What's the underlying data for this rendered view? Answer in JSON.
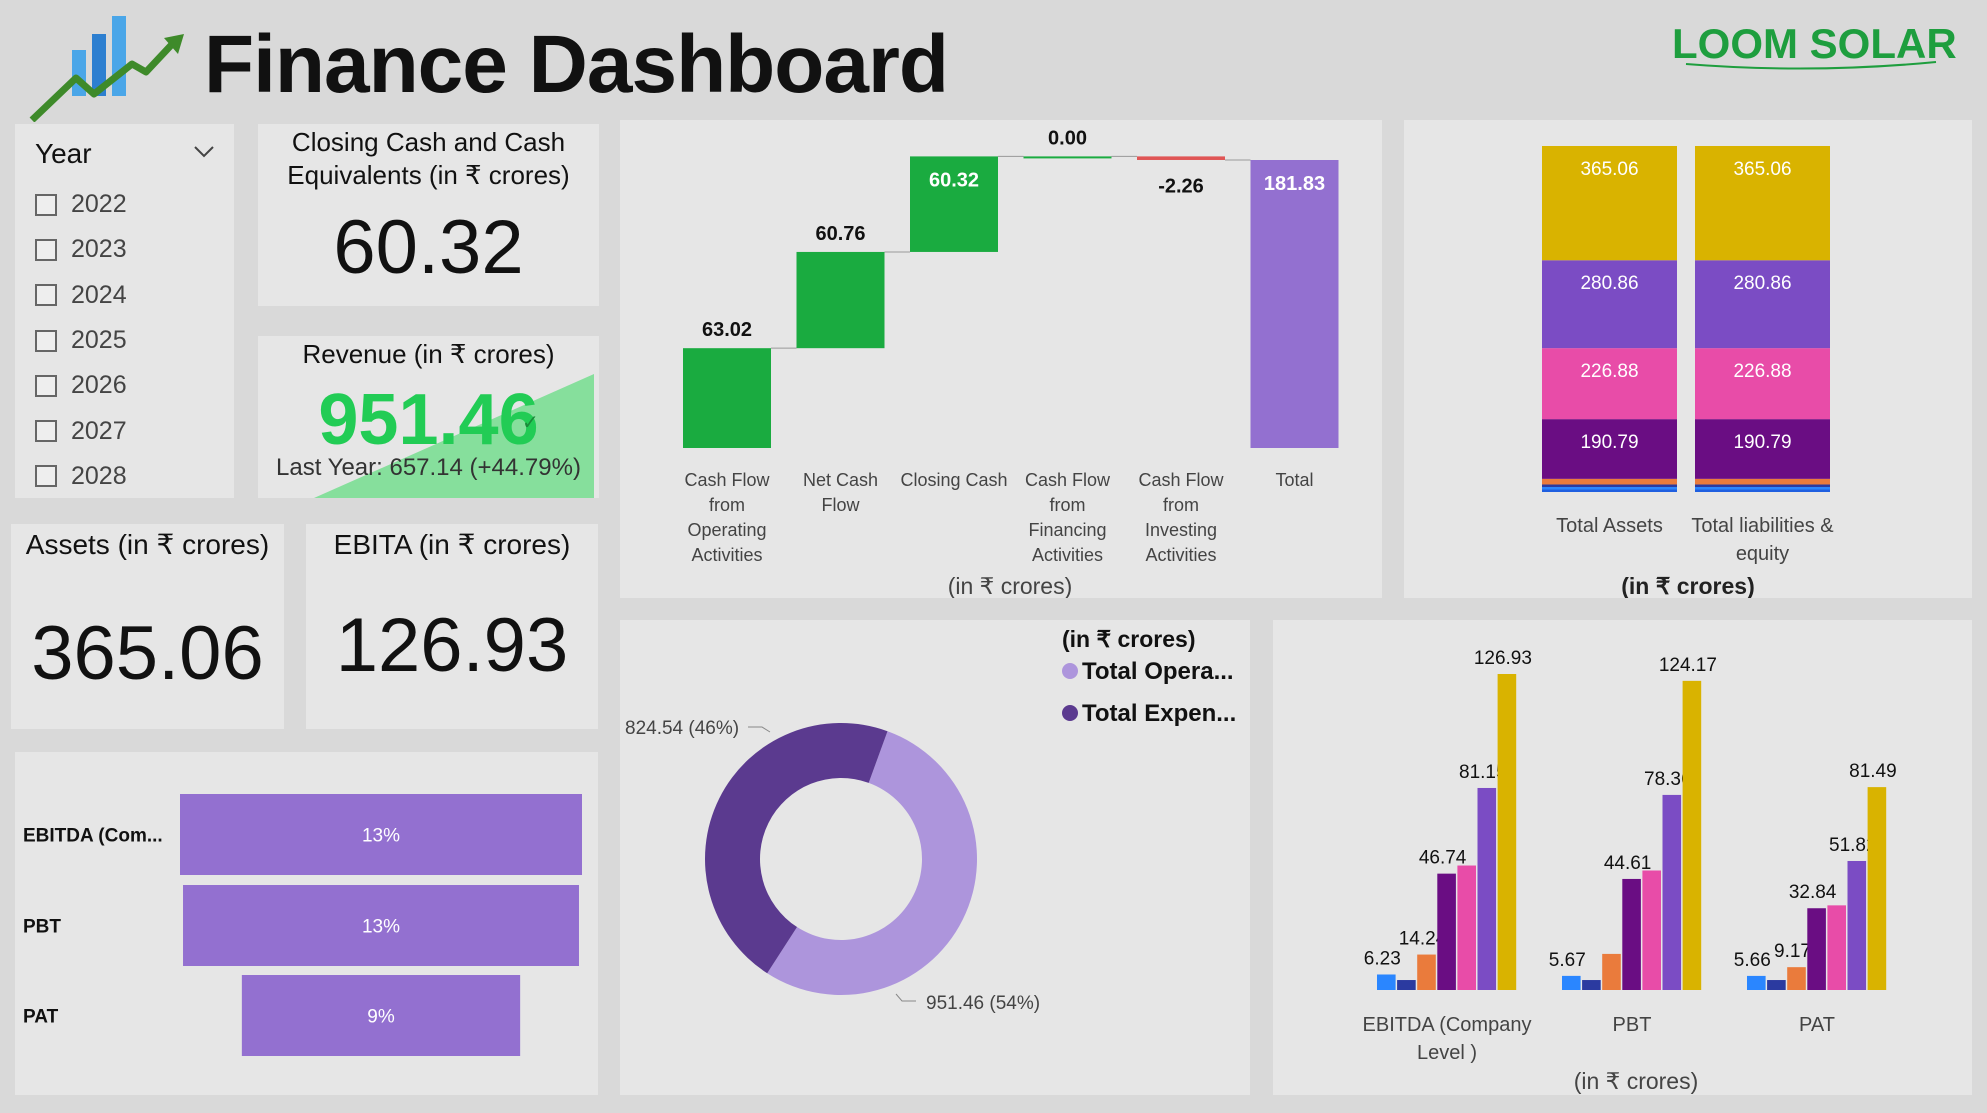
{
  "header": {
    "title": "Finance Dashboard",
    "brand": "LOOM SOLAR",
    "colors": {
      "brand_green": "#1e9e3e"
    }
  },
  "year_slicer": {
    "title": "Year",
    "options": [
      "2022",
      "2023",
      "2024",
      "2025",
      "2026",
      "2027",
      "2028"
    ]
  },
  "kpis": {
    "closing_cash": {
      "title": "Closing Cash and Cash Equivalents (in ₹ crores)",
      "value": "60.32"
    },
    "revenue": {
      "title": "Revenue (in ₹ crores)",
      "value": "951.46",
      "subtext": "Last Year: 657.14 (+44.79%)",
      "status_color": "#22cc55"
    },
    "assets": {
      "title": "Assets (in ₹ crores)",
      "value": "365.06"
    },
    "ebita": {
      "title": "EBITA (in ₹ crores)",
      "value": "126.93"
    }
  },
  "chart_data": [
    {
      "id": "waterfall",
      "type": "bar",
      "subtype": "waterfall",
      "categories": [
        "Cash Flow from Operating Activities",
        "Net Cash Flow",
        "Closing Cash",
        "Cash Flow from Financing Activities",
        "Cash Flow from Investing Activities",
        "Total"
      ],
      "category_lines": [
        [
          "Cash Flow",
          "from",
          "Operating",
          "Activities"
        ],
        [
          "Net Cash",
          "Flow"
        ],
        [
          "Closing Cash"
        ],
        [
          "Cash Flow",
          "from",
          "Financing",
          "Activities"
        ],
        [
          "Cash Flow",
          "from",
          "Investing",
          "Activities"
        ],
        [
          "Total"
        ]
      ],
      "values": [
        63.02,
        60.76,
        60.32,
        0.0,
        -2.26,
        181.83
      ],
      "value_labels": [
        "63.02",
        "60.76",
        "60.32",
        "0.00",
        "-2.26",
        "181.83"
      ],
      "colors": {
        "increase": "#1aab40",
        "decrease": "#e05555",
        "total": "#9370d0"
      },
      "xlabel": "(in ₹ crores)",
      "ylim": [
        0,
        181.83
      ]
    },
    {
      "id": "stacked",
      "type": "bar",
      "subtype": "stacked",
      "categories": [
        "Total Assets",
        "Total liabilities & equity"
      ],
      "category_lines": [
        [
          "Total Assets"
        ],
        [
          "Total liabilities &",
          "equity"
        ]
      ],
      "series": [
        {
          "values": [
            8,
            8
          ],
          "color": "#1f5fe0"
        },
        {
          "values": [
            8,
            8
          ],
          "color": "#2a86ff"
        },
        {
          "values": [
            8,
            8
          ],
          "color": "#2b3aa0"
        },
        {
          "values": [
            18,
            18
          ],
          "color": "#ea7b3c"
        },
        {
          "values": [
            190.79,
            190.79
          ],
          "color": "#6a0d83"
        },
        {
          "values": [
            226.88,
            226.88
          ],
          "color": "#e84ca8"
        },
        {
          "values": [
            280.86,
            280.86
          ],
          "color": "#7b4cc4"
        },
        {
          "values": [
            365.06,
            365.06
          ],
          "color": "#d9b300"
        }
      ],
      "value_labels": [
        "190.79",
        "226.88",
        "280.86",
        "365.06"
      ],
      "xlabel": "(in ₹ crores)"
    },
    {
      "id": "funnel",
      "type": "bar",
      "subtype": "funnel",
      "categories": [
        "EBITDA (Com...",
        "PBT",
        "PAT"
      ],
      "values": [
        13,
        13,
        9
      ],
      "value_labels": [
        "13%",
        "13%",
        "9%"
      ],
      "color": "#9370d0"
    },
    {
      "id": "donut",
      "type": "pie",
      "subtype": "donut",
      "legend_title": "(in ₹ crores)",
      "legend_position": "top-right",
      "slices": [
        {
          "label": "Total Opera...",
          "value": 951.46,
          "percent": 54,
          "data_label": "951.46 (54%)",
          "color": "#ad95dc"
        },
        {
          "label": "Total Expen...",
          "value": 824.54,
          "percent": 46,
          "data_label": "824.54 (46%)",
          "color": "#5b3a8f"
        }
      ]
    },
    {
      "id": "clustered",
      "type": "bar",
      "subtype": "clustered",
      "categories": [
        "EBITDA (Company Level )",
        "PBT",
        "PAT"
      ],
      "category_lines": [
        [
          "EBITDA (Company",
          "Level )"
        ],
        [
          "PBT"
        ],
        [
          "PAT"
        ]
      ],
      "series": [
        {
          "values": [
            6.23,
            5.67,
            5.66
          ],
          "color": "#2a86ff"
        },
        {
          "values": [
            4,
            4,
            4
          ],
          "color": "#2b3aa0"
        },
        {
          "values": [
            14.24,
            14.5,
            9.17
          ],
          "color": "#ea7b3c"
        },
        {
          "values": [
            46.74,
            44.61,
            32.84
          ],
          "color": "#6a0d83"
        },
        {
          "values": [
            50,
            48,
            34
          ],
          "color": "#e84ca8"
        },
        {
          "values": [
            81.15,
            78.36,
            51.82
          ],
          "color": "#7b4cc4"
        },
        {
          "values": [
            126.93,
            124.17,
            81.49
          ],
          "color": "#d9b300"
        }
      ],
      "data_labels": [
        [
          "6.23",
          "",
          "14.24",
          "46.74",
          "",
          "81.15",
          "126.93"
        ],
        [
          "5.67",
          "",
          "",
          "44.61",
          "",
          "78.36",
          "124.17"
        ],
        [
          "5.66",
          "",
          "9.17",
          "32.84",
          "",
          "51.82",
          "81.49"
        ]
      ],
      "xlabel": "(in ₹ crores)",
      "ylim": [
        0,
        126.93
      ]
    }
  ]
}
